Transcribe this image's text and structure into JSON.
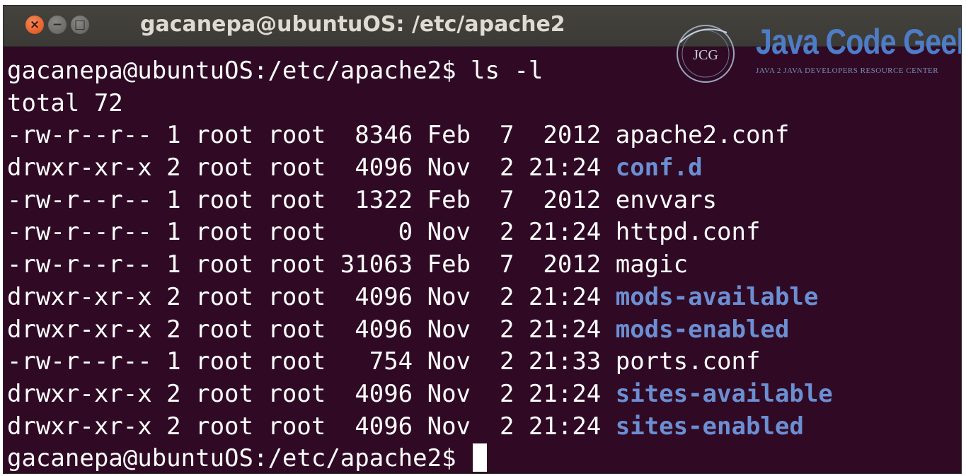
{
  "window": {
    "title": "gacanepa@ubuntuOS: /etc/apache2",
    "buttons": {
      "close": "×",
      "minimize": "−",
      "maximize": "□"
    }
  },
  "watermark": {
    "badge_text": "JCG",
    "brand": "Java Code Geeks",
    "tagline": "JAVA 2 JAVA DEVELOPERS RESOURCE CENTER"
  },
  "terminal": {
    "prompt": "gacanepa@ubuntuOS:/etc/apache2$",
    "command": "ls -l",
    "total": "total 72",
    "colors": {
      "background": "#300a24",
      "text": "#ffffff",
      "directory": "#6c8ed3"
    },
    "entries": [
      {
        "meta": "-rw-r--r-- 1 root root  8346 Feb  7  2012 ",
        "name": "apache2.conf",
        "type": "file"
      },
      {
        "meta": "drwxr-xr-x 2 root root  4096 Nov  2 21:24 ",
        "name": "conf.d",
        "type": "dir"
      },
      {
        "meta": "-rw-r--r-- 1 root root  1322 Feb  7  2012 ",
        "name": "envvars",
        "type": "file"
      },
      {
        "meta": "-rw-r--r-- 1 root root     0 Nov  2 21:24 ",
        "name": "httpd.conf",
        "type": "file"
      },
      {
        "meta": "-rw-r--r-- 1 root root 31063 Feb  7  2012 ",
        "name": "magic",
        "type": "file"
      },
      {
        "meta": "drwxr-xr-x 2 root root  4096 Nov  2 21:24 ",
        "name": "mods-available",
        "type": "dir"
      },
      {
        "meta": "drwxr-xr-x 2 root root  4096 Nov  2 21:24 ",
        "name": "mods-enabled",
        "type": "dir"
      },
      {
        "meta": "-rw-r--r-- 1 root root   754 Nov  2 21:33 ",
        "name": "ports.conf",
        "type": "file"
      },
      {
        "meta": "drwxr-xr-x 2 root root  4096 Nov  2 21:24 ",
        "name": "sites-available",
        "type": "dir"
      },
      {
        "meta": "drwxr-xr-x 2 root root  4096 Nov  2 21:24 ",
        "name": "sites-enabled",
        "type": "dir"
      }
    ],
    "final_prompt": "gacanepa@ubuntuOS:/etc/apache2$ "
  }
}
